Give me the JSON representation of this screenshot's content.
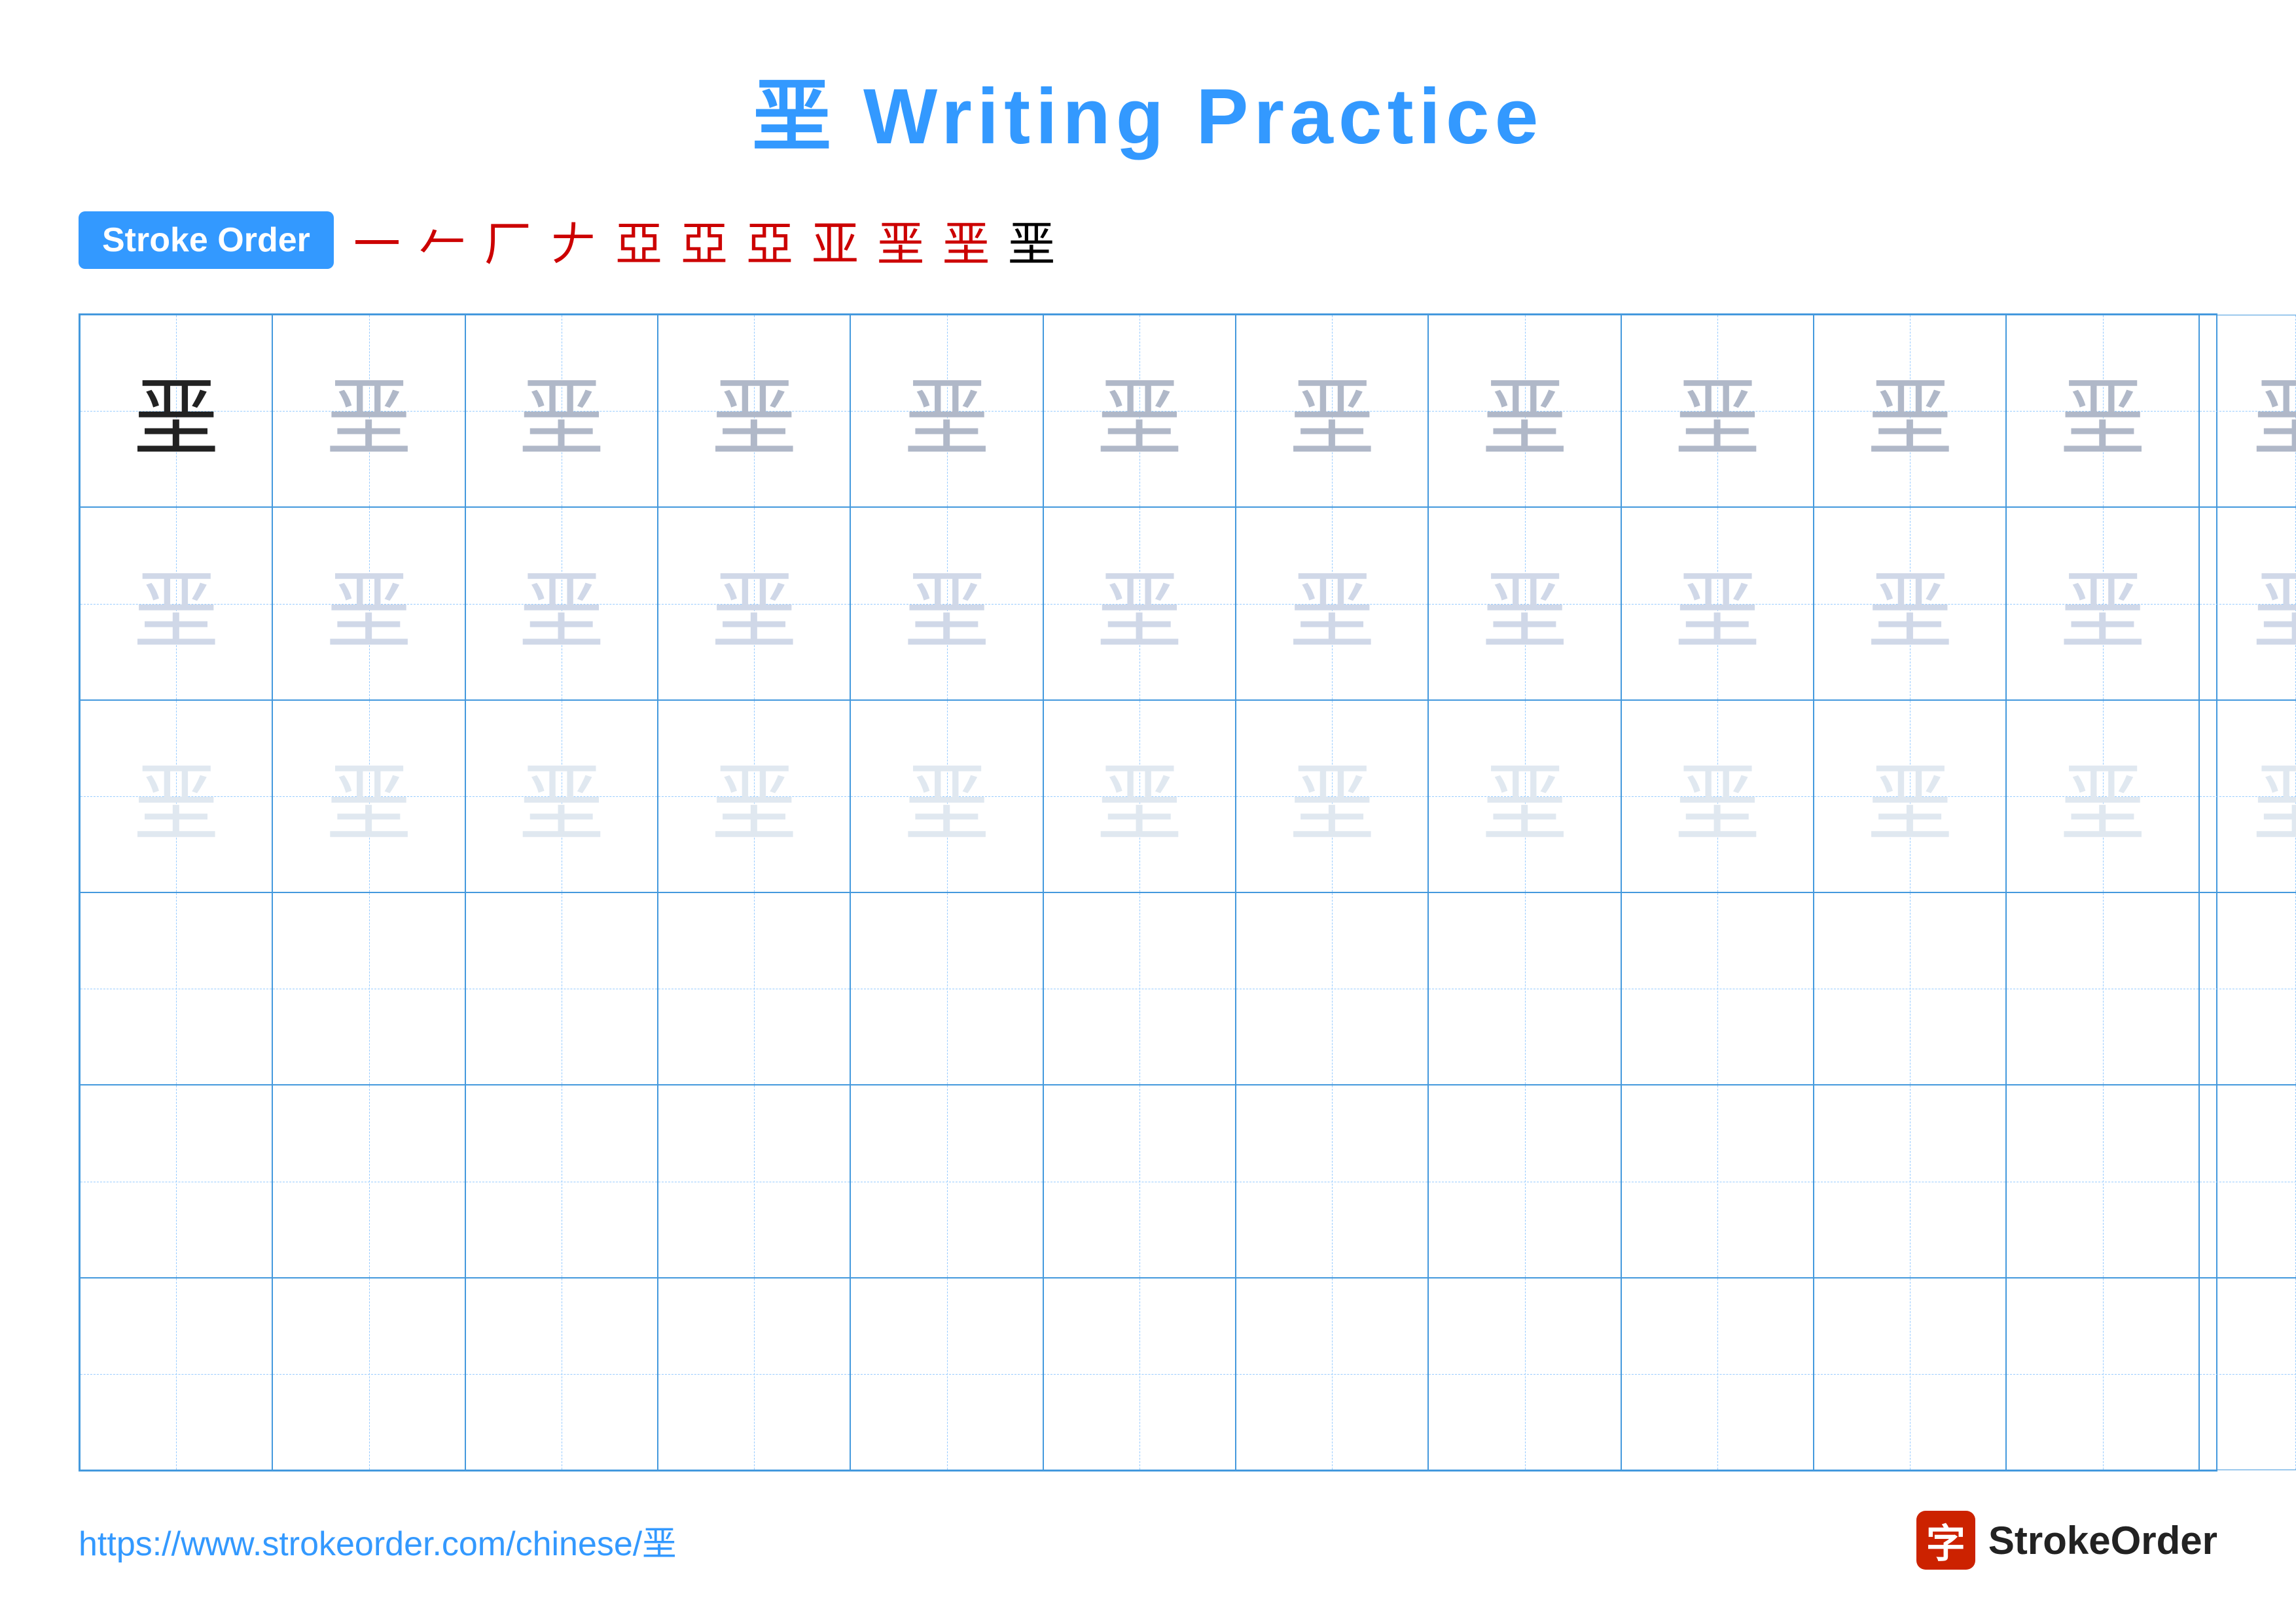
{
  "title": {
    "char": "垩",
    "suffix": " Writing Practice"
  },
  "stroke_order": {
    "badge_label": "Stroke Order",
    "steps": [
      "一",
      "厂",
      "厂",
      "厂",
      "亚",
      "亚",
      "亚",
      "亚",
      "垩",
      "垩",
      "垩"
    ]
  },
  "grid": {
    "rows": 6,
    "cols": 13,
    "char": "垩",
    "cells": [
      "solid",
      "medium-gray",
      "medium-gray",
      "medium-gray",
      "medium-gray",
      "medium-gray",
      "medium-gray",
      "medium-gray",
      "medium-gray",
      "medium-gray",
      "medium-gray",
      "medium-gray",
      "medium-gray",
      "light-gray",
      "light-gray",
      "light-gray",
      "light-gray",
      "light-gray",
      "light-gray",
      "light-gray",
      "light-gray",
      "light-gray",
      "light-gray",
      "light-gray",
      "light-gray",
      "light-gray",
      "very-light",
      "very-light",
      "very-light",
      "very-light",
      "very-light",
      "very-light",
      "very-light",
      "very-light",
      "very-light",
      "very-light",
      "very-light",
      "very-light",
      "very-light",
      "empty",
      "empty",
      "empty",
      "empty",
      "empty",
      "empty",
      "empty",
      "empty",
      "empty",
      "empty",
      "empty",
      "empty",
      "empty",
      "empty",
      "empty",
      "empty",
      "empty",
      "empty",
      "empty",
      "empty",
      "empty",
      "empty",
      "empty",
      "empty",
      "empty",
      "empty",
      "empty",
      "empty",
      "empty",
      "empty",
      "empty",
      "empty",
      "empty",
      "empty",
      "empty",
      "empty",
      "empty",
      "empty",
      "empty"
    ]
  },
  "footer": {
    "url": "https://www.strokeorder.com/chinese/垩",
    "brand_name": "StrokeOrder",
    "brand_char": "字"
  }
}
